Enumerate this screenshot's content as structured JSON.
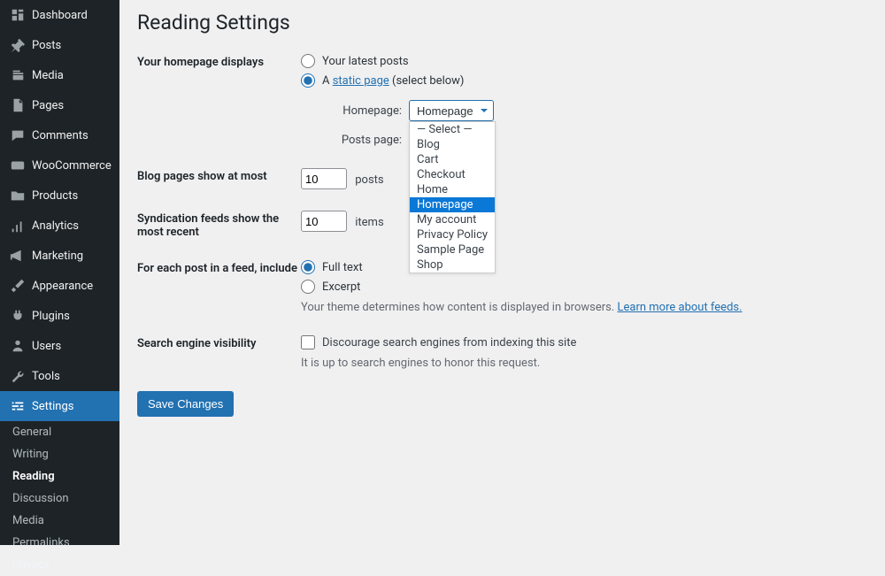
{
  "sidebar": {
    "items": [
      {
        "label": "Dashboard",
        "id": "dashboard"
      },
      {
        "label": "Posts",
        "id": "posts"
      },
      {
        "label": "Media",
        "id": "media"
      },
      {
        "label": "Pages",
        "id": "pages"
      },
      {
        "label": "Comments",
        "id": "comments"
      },
      {
        "label": "WooCommerce",
        "id": "woocommerce"
      },
      {
        "label": "Products",
        "id": "products"
      },
      {
        "label": "Analytics",
        "id": "analytics"
      },
      {
        "label": "Marketing",
        "id": "marketing"
      },
      {
        "label": "Appearance",
        "id": "appearance"
      },
      {
        "label": "Plugins",
        "id": "plugins"
      },
      {
        "label": "Users",
        "id": "users"
      },
      {
        "label": "Tools",
        "id": "tools"
      },
      {
        "label": "Settings",
        "id": "settings"
      }
    ],
    "subItems": [
      "General",
      "Writing",
      "Reading",
      "Discussion",
      "Media",
      "Permalinks",
      "Privacy"
    ],
    "subActive": "Reading"
  },
  "page": {
    "title": "Reading Settings",
    "homepageDisplays": {
      "label": "Your homepage displays",
      "optLatest": "Your latest posts",
      "optStaticA": "A ",
      "optStaticLink": "static page",
      "optStaticB": " (select below)",
      "homepageLabel": "Homepage:",
      "homepageValue": "Homepage",
      "postsPageLabel": "Posts page:",
      "dropdownOptions": [
        "— Select —",
        "Blog",
        "Cart",
        "Checkout",
        "Home",
        "Homepage",
        "My account",
        "Privacy Policy",
        "Sample Page",
        "Shop"
      ],
      "dropdownSelected": "Homepage"
    },
    "blogPages": {
      "label": "Blog pages show at most",
      "value": "10",
      "suffix": "posts"
    },
    "syndication": {
      "label": "Syndication feeds show the most recent",
      "value": "10",
      "suffix": "items"
    },
    "feedInclude": {
      "label": "For each post in a feed, include",
      "optFull": "Full text",
      "optExcerpt": "Excerpt",
      "desc": "Your theme determines how content is displayed in browsers. ",
      "descLink": "Learn more about feeds."
    },
    "searchEngine": {
      "label": "Search engine visibility",
      "checkLabel": "Discourage search engines from indexing this site",
      "desc": "It is up to search engines to honor this request."
    },
    "saveButton": "Save Changes"
  }
}
